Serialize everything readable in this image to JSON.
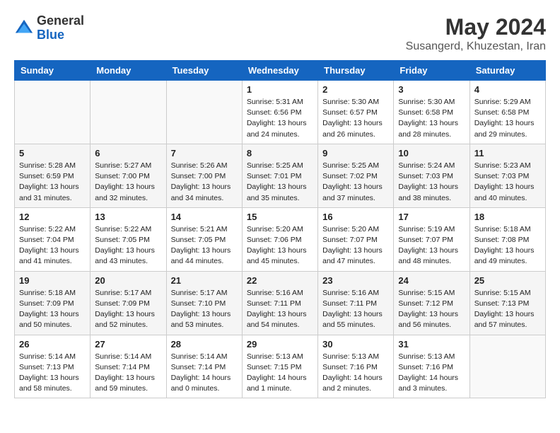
{
  "header": {
    "logo_line1": "General",
    "logo_line2": "Blue",
    "month_year": "May 2024",
    "location": "Susangerd, Khuzestan, Iran"
  },
  "weekdays": [
    "Sunday",
    "Monday",
    "Tuesday",
    "Wednesday",
    "Thursday",
    "Friday",
    "Saturday"
  ],
  "weeks": [
    [
      {
        "day": "",
        "sunrise": "",
        "sunset": "",
        "daylight": ""
      },
      {
        "day": "",
        "sunrise": "",
        "sunset": "",
        "daylight": ""
      },
      {
        "day": "",
        "sunrise": "",
        "sunset": "",
        "daylight": ""
      },
      {
        "day": "1",
        "sunrise": "Sunrise: 5:31 AM",
        "sunset": "Sunset: 6:56 PM",
        "daylight": "Daylight: 13 hours and 24 minutes."
      },
      {
        "day": "2",
        "sunrise": "Sunrise: 5:30 AM",
        "sunset": "Sunset: 6:57 PM",
        "daylight": "Daylight: 13 hours and 26 minutes."
      },
      {
        "day": "3",
        "sunrise": "Sunrise: 5:30 AM",
        "sunset": "Sunset: 6:58 PM",
        "daylight": "Daylight: 13 hours and 28 minutes."
      },
      {
        "day": "4",
        "sunrise": "Sunrise: 5:29 AM",
        "sunset": "Sunset: 6:58 PM",
        "daylight": "Daylight: 13 hours and 29 minutes."
      }
    ],
    [
      {
        "day": "5",
        "sunrise": "Sunrise: 5:28 AM",
        "sunset": "Sunset: 6:59 PM",
        "daylight": "Daylight: 13 hours and 31 minutes."
      },
      {
        "day": "6",
        "sunrise": "Sunrise: 5:27 AM",
        "sunset": "Sunset: 7:00 PM",
        "daylight": "Daylight: 13 hours and 32 minutes."
      },
      {
        "day": "7",
        "sunrise": "Sunrise: 5:26 AM",
        "sunset": "Sunset: 7:00 PM",
        "daylight": "Daylight: 13 hours and 34 minutes."
      },
      {
        "day": "8",
        "sunrise": "Sunrise: 5:25 AM",
        "sunset": "Sunset: 7:01 PM",
        "daylight": "Daylight: 13 hours and 35 minutes."
      },
      {
        "day": "9",
        "sunrise": "Sunrise: 5:25 AM",
        "sunset": "Sunset: 7:02 PM",
        "daylight": "Daylight: 13 hours and 37 minutes."
      },
      {
        "day": "10",
        "sunrise": "Sunrise: 5:24 AM",
        "sunset": "Sunset: 7:03 PM",
        "daylight": "Daylight: 13 hours and 38 minutes."
      },
      {
        "day": "11",
        "sunrise": "Sunrise: 5:23 AM",
        "sunset": "Sunset: 7:03 PM",
        "daylight": "Daylight: 13 hours and 40 minutes."
      }
    ],
    [
      {
        "day": "12",
        "sunrise": "Sunrise: 5:22 AM",
        "sunset": "Sunset: 7:04 PM",
        "daylight": "Daylight: 13 hours and 41 minutes."
      },
      {
        "day": "13",
        "sunrise": "Sunrise: 5:22 AM",
        "sunset": "Sunset: 7:05 PM",
        "daylight": "Daylight: 13 hours and 43 minutes."
      },
      {
        "day": "14",
        "sunrise": "Sunrise: 5:21 AM",
        "sunset": "Sunset: 7:05 PM",
        "daylight": "Daylight: 13 hours and 44 minutes."
      },
      {
        "day": "15",
        "sunrise": "Sunrise: 5:20 AM",
        "sunset": "Sunset: 7:06 PM",
        "daylight": "Daylight: 13 hours and 45 minutes."
      },
      {
        "day": "16",
        "sunrise": "Sunrise: 5:20 AM",
        "sunset": "Sunset: 7:07 PM",
        "daylight": "Daylight: 13 hours and 47 minutes."
      },
      {
        "day": "17",
        "sunrise": "Sunrise: 5:19 AM",
        "sunset": "Sunset: 7:07 PM",
        "daylight": "Daylight: 13 hours and 48 minutes."
      },
      {
        "day": "18",
        "sunrise": "Sunrise: 5:18 AM",
        "sunset": "Sunset: 7:08 PM",
        "daylight": "Daylight: 13 hours and 49 minutes."
      }
    ],
    [
      {
        "day": "19",
        "sunrise": "Sunrise: 5:18 AM",
        "sunset": "Sunset: 7:09 PM",
        "daylight": "Daylight: 13 hours and 50 minutes."
      },
      {
        "day": "20",
        "sunrise": "Sunrise: 5:17 AM",
        "sunset": "Sunset: 7:09 PM",
        "daylight": "Daylight: 13 hours and 52 minutes."
      },
      {
        "day": "21",
        "sunrise": "Sunrise: 5:17 AM",
        "sunset": "Sunset: 7:10 PM",
        "daylight": "Daylight: 13 hours and 53 minutes."
      },
      {
        "day": "22",
        "sunrise": "Sunrise: 5:16 AM",
        "sunset": "Sunset: 7:11 PM",
        "daylight": "Daylight: 13 hours and 54 minutes."
      },
      {
        "day": "23",
        "sunrise": "Sunrise: 5:16 AM",
        "sunset": "Sunset: 7:11 PM",
        "daylight": "Daylight: 13 hours and 55 minutes."
      },
      {
        "day": "24",
        "sunrise": "Sunrise: 5:15 AM",
        "sunset": "Sunset: 7:12 PM",
        "daylight": "Daylight: 13 hours and 56 minutes."
      },
      {
        "day": "25",
        "sunrise": "Sunrise: 5:15 AM",
        "sunset": "Sunset: 7:13 PM",
        "daylight": "Daylight: 13 hours and 57 minutes."
      }
    ],
    [
      {
        "day": "26",
        "sunrise": "Sunrise: 5:14 AM",
        "sunset": "Sunset: 7:13 PM",
        "daylight": "Daylight: 13 hours and 58 minutes."
      },
      {
        "day": "27",
        "sunrise": "Sunrise: 5:14 AM",
        "sunset": "Sunset: 7:14 PM",
        "daylight": "Daylight: 13 hours and 59 minutes."
      },
      {
        "day": "28",
        "sunrise": "Sunrise: 5:14 AM",
        "sunset": "Sunset: 7:14 PM",
        "daylight": "Daylight: 14 hours and 0 minutes."
      },
      {
        "day": "29",
        "sunrise": "Sunrise: 5:13 AM",
        "sunset": "Sunset: 7:15 PM",
        "daylight": "Daylight: 14 hours and 1 minute."
      },
      {
        "day": "30",
        "sunrise": "Sunrise: 5:13 AM",
        "sunset": "Sunset: 7:16 PM",
        "daylight": "Daylight: 14 hours and 2 minutes."
      },
      {
        "day": "31",
        "sunrise": "Sunrise: 5:13 AM",
        "sunset": "Sunset: 7:16 PM",
        "daylight": "Daylight: 14 hours and 3 minutes."
      },
      {
        "day": "",
        "sunrise": "",
        "sunset": "",
        "daylight": ""
      }
    ]
  ]
}
